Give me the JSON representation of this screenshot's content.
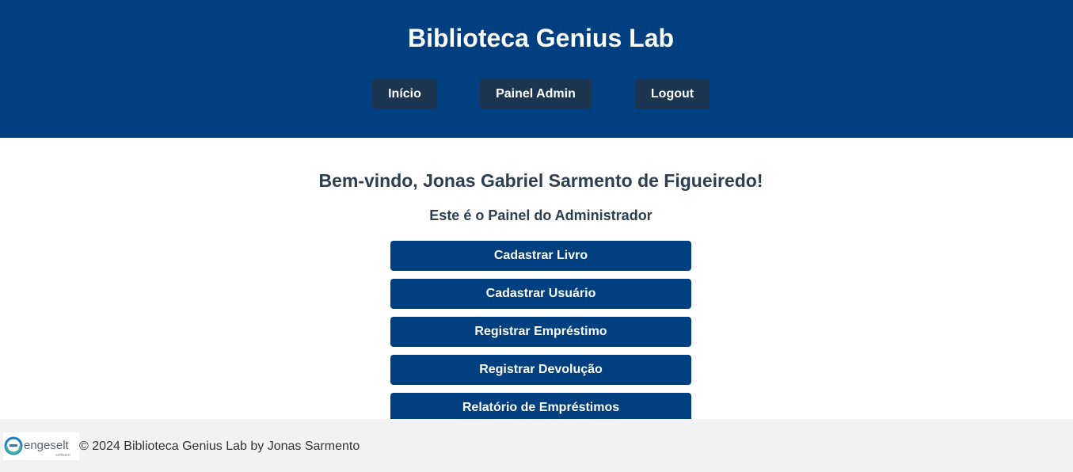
{
  "header": {
    "title": "Biblioteca Genius Lab",
    "nav": {
      "home": "Início",
      "admin": "Painel Admin",
      "logout": "Logout"
    },
    "bg_color": "#003f80",
    "nav_btn_color": "#1c3550"
  },
  "main": {
    "welcome": "Bem-vindo, Jonas Gabriel Sarmento de Figueiredo!",
    "subtitle": "Este é o Painel do Administrador",
    "actions": {
      "register_book": "Cadastrar Livro",
      "register_user": "Cadastrar Usuário",
      "register_loan": "Registrar Empréstimo",
      "register_return": "Registrar Devolução",
      "loan_report": "Relatório de Empréstimos"
    },
    "button_color": "#003f80",
    "text_color": "#2c3e50"
  },
  "footer": {
    "logo_text": "engeselt",
    "logo_subtext": "software",
    "copyright": "© 2024 Biblioteca Genius Lab by Jonas Sarmento",
    "bg_color": "#f2f2f2"
  }
}
